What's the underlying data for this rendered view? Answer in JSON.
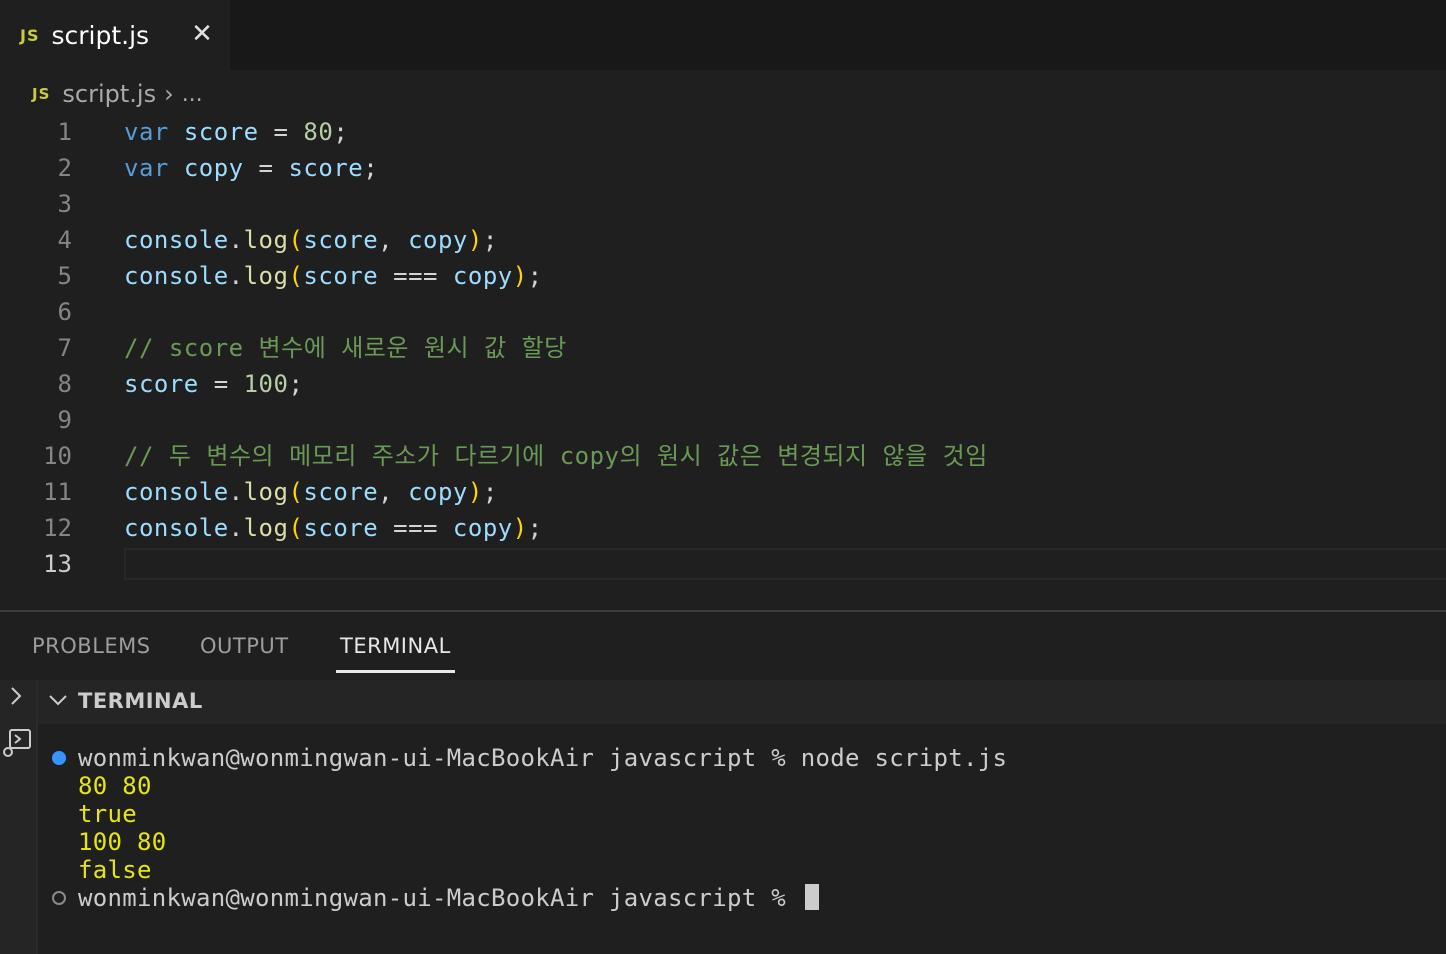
{
  "tab": {
    "badge": "JS",
    "filename": "script.js",
    "close": "✕"
  },
  "breadcrumb": {
    "badge": "JS",
    "file": "script.js",
    "separator": "›",
    "more": "..."
  },
  "editor": {
    "lines": [
      {
        "n": "1"
      },
      {
        "n": "2"
      },
      {
        "n": "3"
      },
      {
        "n": "4"
      },
      {
        "n": "5"
      },
      {
        "n": "6"
      },
      {
        "n": "7"
      },
      {
        "n": "8"
      },
      {
        "n": "9"
      },
      {
        "n": "10"
      },
      {
        "n": "11"
      },
      {
        "n": "12"
      },
      {
        "n": "13"
      }
    ],
    "tokens": {
      "var": "var",
      "score": "score",
      "copy": "copy",
      "eq": " = ",
      "semi": ";",
      "n80": "80",
      "n100": "100",
      "console": "console",
      "dot": ".",
      "log": "log",
      "lp": "(",
      "rp": ")",
      "comma": ", ",
      "seq": " === ",
      "comment7": "// score 변수에 새로운 원시 값 할당",
      "comment10": "// 두 변수의 메모리 주소가 다르기에 copy의 원시 값은 변경되지 않을 것임"
    }
  },
  "panel": {
    "tabs": [
      "PROBLEMS",
      "OUTPUT",
      "TERMINAL"
    ],
    "active_tab": "TERMINAL",
    "terminal_title": "TERMINAL"
  },
  "terminal": {
    "prompt_cmd": "wonminkwan@wonmingwan-ui-MacBookAir javascript % node script.js",
    "output": [
      "80 80",
      "true",
      "100 80",
      "false"
    ],
    "prompt": "wonminkwan@wonmingwan-ui-MacBookAir javascript % "
  },
  "colors": {
    "keyword": "#569cd6",
    "variable": "#9cdcfe",
    "number": "#b5cea8",
    "function": "#dcdcaa",
    "paren": "#ffd700",
    "comment": "#6a9955",
    "terminal_output": "#e5e510",
    "status_dot": "#3794ff"
  }
}
